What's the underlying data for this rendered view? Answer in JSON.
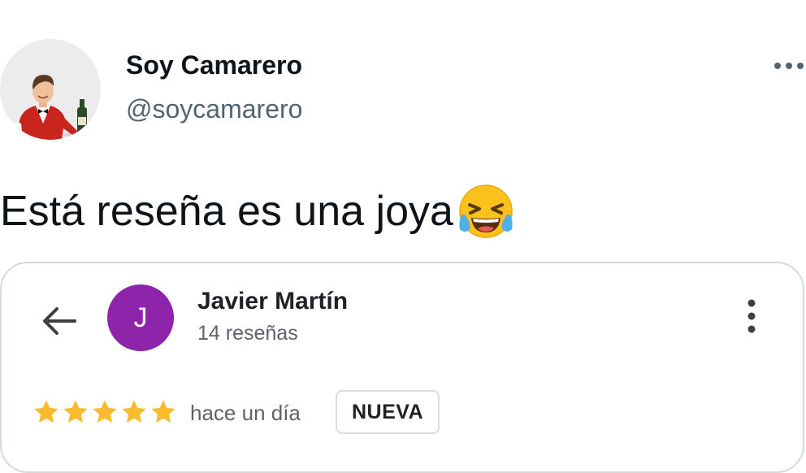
{
  "tweet": {
    "author": {
      "display_name": "Soy Camarero",
      "handle": "@soycamarero",
      "avatar_icon": "waiter-avatar"
    },
    "text": "Está reseña es una joya",
    "emoji_icon": "face-with-tears-of-joy-emoji",
    "more_icon": "more-horizontal-icon"
  },
  "review_card": {
    "back_icon": "arrow-back-icon",
    "reviewer": {
      "initial": "J",
      "name": "Javier Martín",
      "review_count": "14 reseñas",
      "avatar_color": "#8e24aa"
    },
    "more_icon": "more-vertical-icon",
    "rating": 5,
    "rating_max": 5,
    "star_color": "#f9bb2d",
    "date": "hace un día",
    "badge": "NUEVA"
  }
}
